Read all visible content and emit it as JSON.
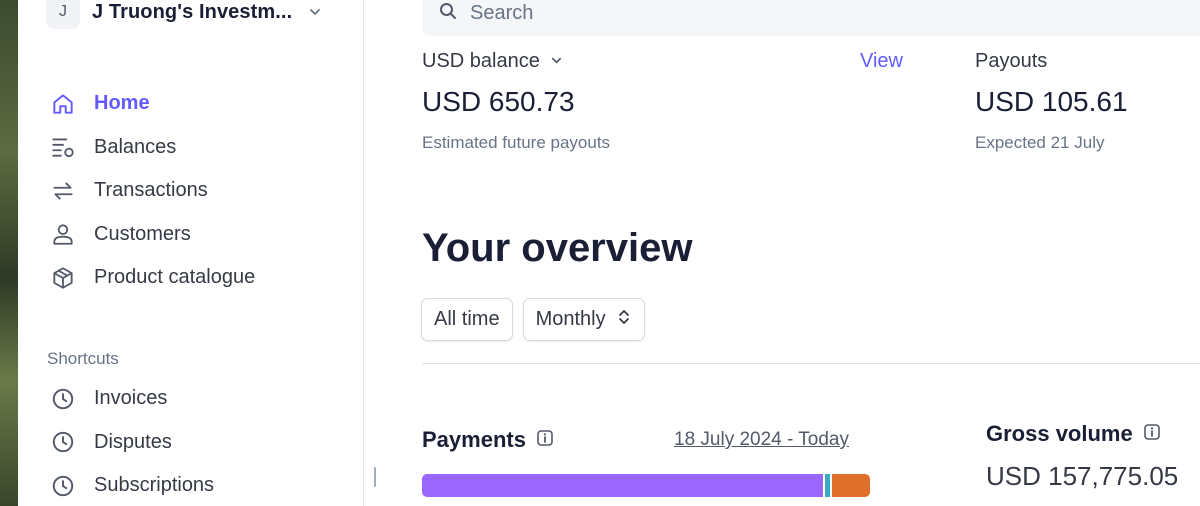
{
  "account": {
    "avatar_letter": "J",
    "name": "J Truong's Investm..."
  },
  "nav": {
    "items": [
      {
        "label": "Home",
        "icon": "home-icon",
        "active": true
      },
      {
        "label": "Balances",
        "icon": "balances-icon",
        "active": false
      },
      {
        "label": "Transactions",
        "icon": "transactions-icon",
        "active": false
      },
      {
        "label": "Customers",
        "icon": "customers-icon",
        "active": false
      },
      {
        "label": "Product catalogue",
        "icon": "product-icon",
        "active": false
      }
    ]
  },
  "shortcuts": {
    "title": "Shortcuts",
    "items": [
      {
        "label": "Invoices",
        "icon": "clock-icon"
      },
      {
        "label": "Disputes",
        "icon": "clock-icon"
      },
      {
        "label": "Subscriptions",
        "icon": "clock-icon"
      }
    ]
  },
  "search": {
    "placeholder": "Search"
  },
  "balance": {
    "label": "USD balance",
    "view_label": "View",
    "amount": "USD 650.73",
    "subtitle": "Estimated future payouts"
  },
  "payouts": {
    "label": "Payouts",
    "amount": "USD 105.61",
    "subtitle": "Expected 21 July"
  },
  "overview": {
    "title": "Your overview",
    "range_filter": "All time",
    "interval_filter": "Monthly"
  },
  "payments": {
    "title": "Payments",
    "date_range": "18 July 2024 - Today",
    "breakdown": [
      {
        "share": 0.895,
        "color": "#9966ff"
      },
      {
        "share": 0.005,
        "color": "#ffffff"
      },
      {
        "share": 0.011,
        "color": "#3aa9c6"
      },
      {
        "share": 0.004,
        "color": "#ffffff"
      },
      {
        "share": 0.085,
        "color": "#e07029"
      }
    ]
  },
  "gross_volume": {
    "title": "Gross volume",
    "amount": "USD 157,775.05"
  },
  "colors": {
    "accent": "#635bff",
    "text": "#1a1f36",
    "muted": "#687385"
  }
}
